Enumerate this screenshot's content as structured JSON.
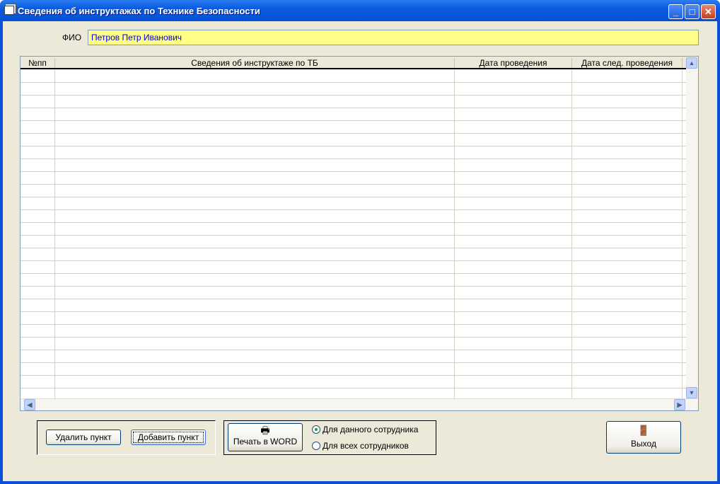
{
  "window": {
    "title": "Сведения об инструктажах по Технике Безопасности",
    "controls": [
      "minimize",
      "maximize",
      "close"
    ]
  },
  "form": {
    "fio_label": "ФИО",
    "fio_value": "Петров Петр Иванович"
  },
  "table": {
    "columns": [
      "№пп",
      "Сведения об инструктаже по ТБ",
      "Дата проведения",
      "Дата след. проведения"
    ],
    "rows": []
  },
  "buttons": {
    "delete": "Удалить пункт",
    "add": "Добавить пункт",
    "print": "Печать в WORD",
    "exit": "Выход"
  },
  "print_options": [
    {
      "label": "Для данного сотрудника",
      "selected": true
    },
    {
      "label": "Для всех сотрудников",
      "selected": false
    }
  ]
}
